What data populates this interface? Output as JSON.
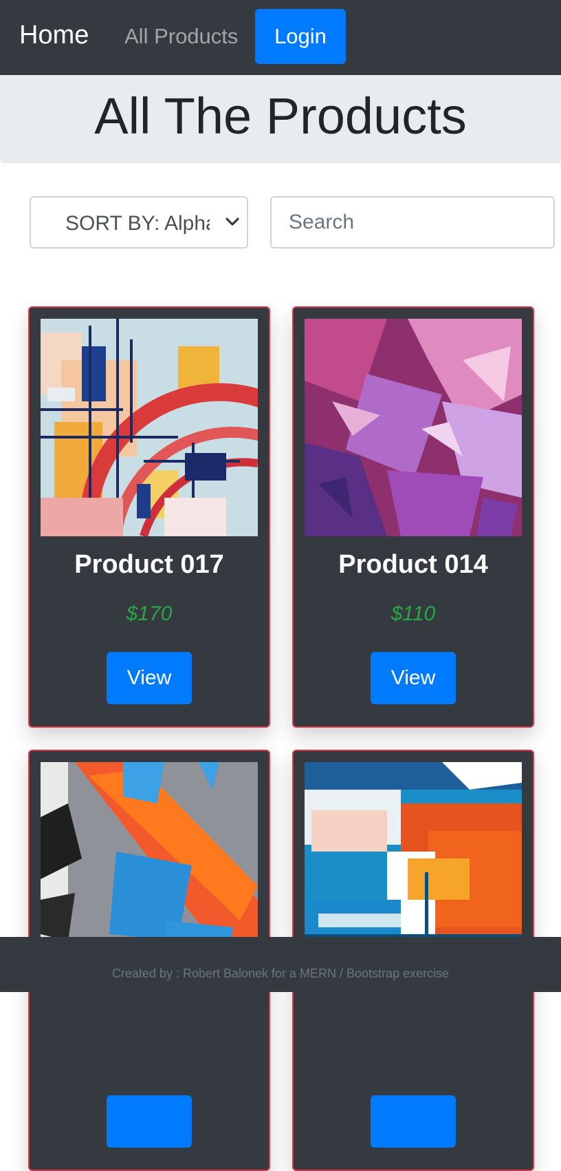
{
  "navbar": {
    "home_label": "Home",
    "products_label": "All Products",
    "login_label": "Login"
  },
  "header": {
    "title": "All The Products"
  },
  "filters": {
    "sort_selected": "SORT BY: Alphabetical",
    "search_placeholder": "Search"
  },
  "products": [
    {
      "name": "Product 017",
      "price": "$170",
      "view_label": "View"
    },
    {
      "name": "Product 014",
      "price": "$110",
      "view_label": "View"
    },
    {
      "name": "",
      "price": "",
      "view_label": ""
    },
    {
      "name": "",
      "price": "",
      "view_label": ""
    }
  ],
  "footer": {
    "text": "Created by : Robert Balonek for a MERN / Bootstrap exercise"
  },
  "colors": {
    "navbar_bg": "#343a40",
    "primary": "#007bff",
    "card_border": "#dc3545",
    "price": "#28a745",
    "jumbotron_bg": "#e9ecef"
  }
}
